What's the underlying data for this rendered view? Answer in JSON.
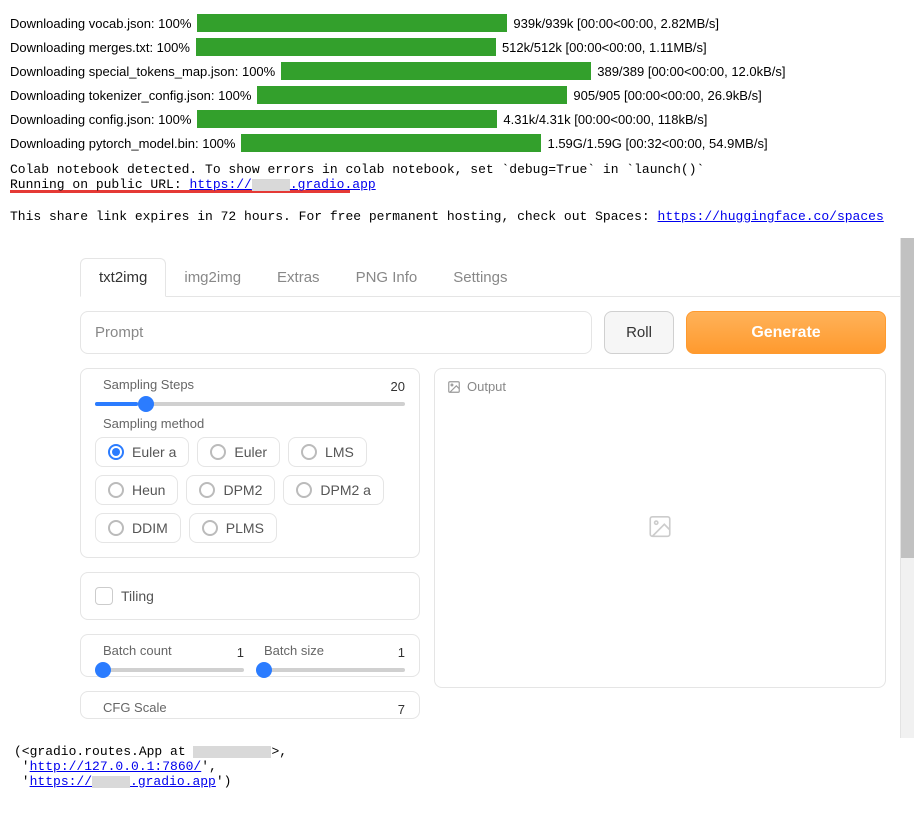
{
  "downloads": [
    {
      "label": "Downloading vocab.json: 100%",
      "bar": 310,
      "stats": "939k/939k [00:00<00:00, 2.82MB/s]"
    },
    {
      "label": "Downloading merges.txt: 100%",
      "bar": 300,
      "stats": "512k/512k [00:00<00:00, 1.11MB/s]"
    },
    {
      "label": "Downloading special_tokens_map.json: 100%",
      "bar": 310,
      "stats": "389/389 [00:00<00:00, 12.0kB/s]"
    },
    {
      "label": "Downloading tokenizer_config.json: 100%",
      "bar": 310,
      "stats": "905/905 [00:00<00:00, 26.9kB/s]"
    },
    {
      "label": "Downloading config.json: 100%",
      "bar": 300,
      "stats": "4.31k/4.31k [00:00<00:00, 118kB/s]"
    },
    {
      "label": "Downloading pytorch_model.bin: 100%",
      "bar": 300,
      "stats": "1.59G/1.59G [00:32<00:00, 54.9MB/s]"
    }
  ],
  "console": {
    "line1a": "Colab notebook detected. To show errors in colab notebook, set `debug=True` in `launch()`",
    "line2a": "Running on public URL: ",
    "line2link": "https://",
    "line2b": ".gradio.app",
    "expire": "This share link expires in 72 hours. For free permanent hosting, check out Spaces: ",
    "spaces_link": "https://huggingface.co/spaces"
  },
  "tabs": [
    "txt2img",
    "img2img",
    "Extras",
    "PNG Info",
    "Settings"
  ],
  "prompt_placeholder": "Prompt",
  "roll_label": "Roll",
  "generate_label": "Generate",
  "sampling_steps": {
    "label": "Sampling Steps",
    "value": "20",
    "fill_pct": 14
  },
  "sampling_method": {
    "label": "Sampling method",
    "options": [
      "Euler a",
      "Euler",
      "LMS",
      "Heun",
      "DPM2",
      "DPM2 a",
      "DDIM",
      "PLMS"
    ],
    "selected": "Euler a"
  },
  "tiling_label": "Tiling",
  "batch_count": {
    "label": "Batch count",
    "value": "1",
    "fill_pct": 0
  },
  "batch_size": {
    "label": "Batch size",
    "value": "1",
    "fill_pct": 0
  },
  "cfg": {
    "label": "CFG Scale",
    "value": "7"
  },
  "output_label": "Output",
  "footer": {
    "l1a": "(<gradio.routes.App at ",
    "l1b": ">,",
    "l2link": "http://127.0.0.1:7860/",
    "l3a": "https://",
    "l3b": ".gradio.app"
  }
}
